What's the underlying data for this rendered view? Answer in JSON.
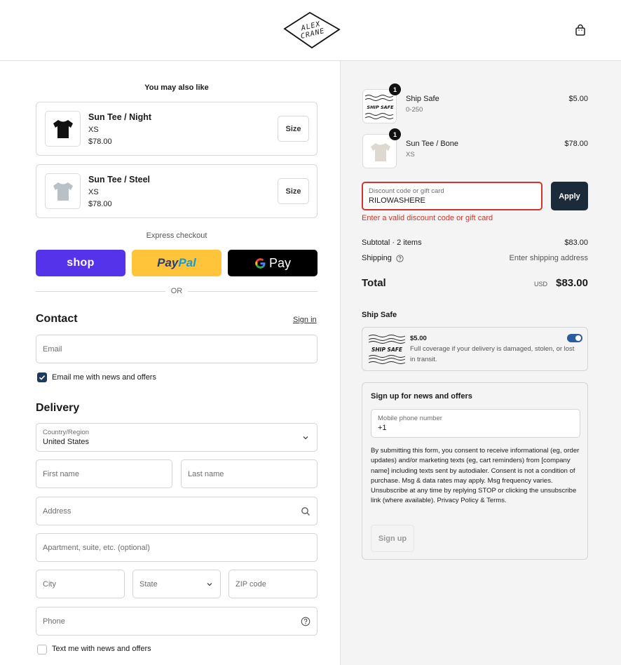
{
  "header": {
    "logo_line1": "ALEX",
    "logo_line2": "CRANE",
    "cart_icon": "shopping-bag-icon"
  },
  "upsell": {
    "title": "You may also like",
    "items": [
      {
        "name": "Sun Tee / Night",
        "variant": "XS",
        "price": "$78.00",
        "button": "Size",
        "color": "#111111"
      },
      {
        "name": "Sun Tee / Steel",
        "variant": "XS",
        "price": "$78.00",
        "button": "Size",
        "color": "#b9c0c6"
      }
    ]
  },
  "express": {
    "label": "Express checkout",
    "shop_label": "shop",
    "paypal_a": "Pay",
    "paypal_b": "Pal",
    "gpay_label": "Pay",
    "or": "OR"
  },
  "contact": {
    "title": "Contact",
    "signin": "Sign in",
    "email_placeholder": "Email",
    "newsletter_label": "Email me with news and offers",
    "newsletter_checked": true
  },
  "delivery": {
    "title": "Delivery",
    "country_label": "Country/Region",
    "country_value": "United States",
    "first_name": "First name",
    "last_name": "Last name",
    "address": "Address",
    "apartment": "Apartment, suite, etc. (optional)",
    "city": "City",
    "state": "State",
    "zip": "ZIP code",
    "phone": "Phone",
    "sms_label": "Text me with news and offers",
    "sms_checked": false
  },
  "order": {
    "items": [
      {
        "name": "Ship Safe",
        "sub": "0-250",
        "price": "$5.00",
        "qty": "1",
        "thumb_text": "SHIP SAFE"
      },
      {
        "name": "Sun Tee / Bone",
        "sub": "XS",
        "price": "$78.00",
        "qty": "1"
      }
    ],
    "discount_label": "Discount code or gift card",
    "discount_value": "RILOWASHERE",
    "apply": "Apply",
    "error": "Enter a valid discount code or gift card",
    "subtotal_label": "Subtotal · 2 items",
    "subtotal_value": "$83.00",
    "shipping_label": "Shipping",
    "shipping_value": "Enter shipping address",
    "total_label": "Total",
    "currency": "USD",
    "total_value": "$83.00"
  },
  "shipsafe": {
    "title": "Ship Safe",
    "badge": "SHIP SAFE",
    "price": "$5.00",
    "description": "Full coverage if your delivery is damaged, stolen, or lost in transit.",
    "enabled": true
  },
  "signup": {
    "title": "Sign up for news and offers",
    "phone_label": "Mobile phone number",
    "phone_value": "+1",
    "legal": "By submitting this form, you consent to receive informational (eg, order updates) and/or marketing texts (eg, cart reminders) from [company name] including texts sent by autodialer. Consent is not a condition of purchase. Msg & data rates may apply. Msg frequency varies. Unsubscribe at any time by replying STOP or clicking the unsubscribe link (where available). Privacy Policy & Terms.",
    "button": "Sign up"
  },
  "colors": {
    "shop_pay": "#5433eb",
    "paypal": "#ffc439",
    "error": "#d0342c",
    "apply": "#1c2b3a"
  }
}
